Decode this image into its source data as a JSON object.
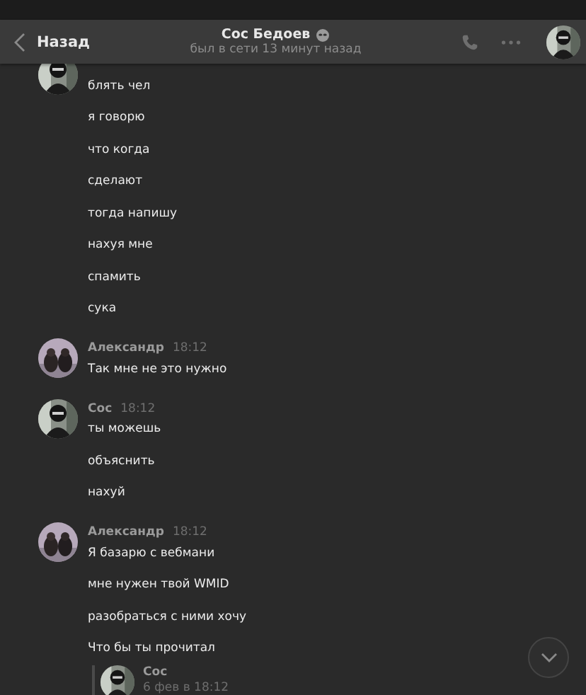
{
  "header": {
    "back_label": "Назад",
    "title": "Сос Бедоев",
    "status": "был в сети 13 минут назад"
  },
  "messages": [
    {
      "lines": [
        "блять чел",
        "я говорю",
        "что когда",
        "сделают",
        "тогда напишу",
        "нахуя мне",
        "спамить",
        "сука"
      ]
    },
    {
      "author": "Александр",
      "time": "18:12",
      "lines": [
        "Так мне не это нужно"
      ]
    },
    {
      "author": "Сос",
      "time": "18:12",
      "lines": [
        "ты можешь",
        "объяснить",
        "нахуй"
      ]
    },
    {
      "author": "Александр",
      "time": "18:12",
      "lines": [
        "Я базарю с вебмани",
        "мне нужен твой WMID",
        "разобраться с ними хочу",
        "Что бы ты прочитал"
      ]
    }
  ],
  "forwarded": {
    "author": "Сос",
    "date": "6 фев в 18:12"
  }
}
